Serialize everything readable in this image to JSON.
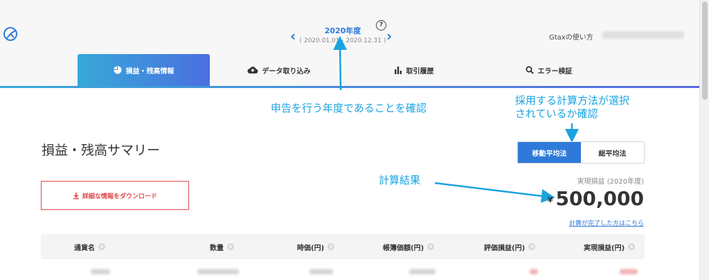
{
  "header": {
    "year_title": "2020年度",
    "year_range": "( 2020.01.01 - 2020.12.31 )",
    "help_label": "?",
    "user_link": "Gtaxの使い方",
    "user_email": ""
  },
  "tabs": [
    {
      "label": "損益・残高情報",
      "icon": "pie-chart-icon",
      "active": true
    },
    {
      "label": "データ取り込み",
      "icon": "cloud-upload-icon",
      "active": false
    },
    {
      "label": "取引履歴",
      "icon": "bar-chart-icon",
      "active": false
    },
    {
      "label": "エラー検証",
      "icon": "search-icon",
      "active": false
    }
  ],
  "annotations": {
    "year_note": "申告を行う年度であることを確認",
    "method_note_line1": "採用する計算方法が選択",
    "method_note_line2": "されているか確認",
    "result_note": "計算結果"
  },
  "summary": {
    "title": "損益・残高サマリー",
    "method_moving_avg": "移動平均法",
    "method_total_avg": "総平均法",
    "download_label": "詳細な情報をダウンロード",
    "realized_label": "実現損益 (2020年度)",
    "currency_symbol": "¥",
    "realized_value": "500,000",
    "calc_link": "計算が完了した方はこちら"
  },
  "table": {
    "headers": [
      "通貨名",
      "数量",
      "時価(円)",
      "帳簿価額(円)",
      "評価損益(円)",
      "実現損益(円)"
    ]
  },
  "colors": {
    "accent": "#2f7ad9",
    "annotation": "#1aa3e0",
    "danger": "#e04c4c"
  }
}
